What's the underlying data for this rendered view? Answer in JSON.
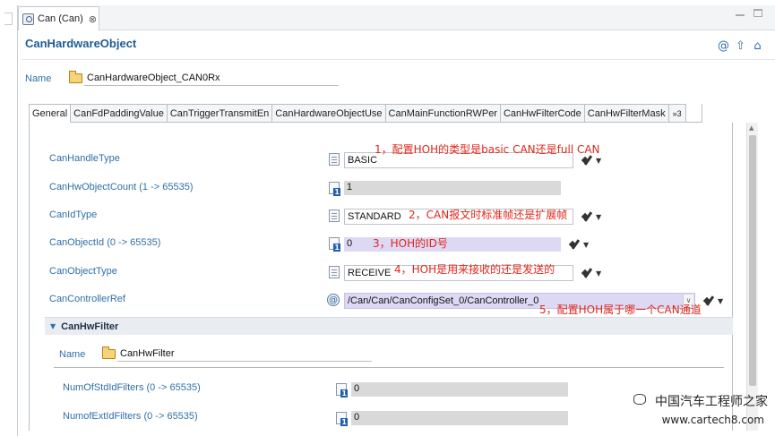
{
  "tab": {
    "label": "Can (Can)",
    "close": "⊗"
  },
  "header": {
    "title": "CanHardwareObject"
  },
  "name_field": {
    "label": "Name",
    "value": "CanHardwareObject_CAN0Rx"
  },
  "subtabs": [
    "General",
    "CanFdPaddingValue",
    "CanTriggerTransmitEn",
    "CanHardwareObjectUse",
    "CanMainFunctionRWPer",
    "CanHwFilterCode",
    "CanHwFilterMask"
  ],
  "subtab_more": "»3",
  "params": {
    "handle_type": {
      "label": "CanHandleType",
      "value": "BASIC"
    },
    "hw_object_count": {
      "label": "CanHwObjectCount (1 -> 65535)",
      "value": "1"
    },
    "id_type": {
      "label": "CanIdType",
      "value": "STANDARD"
    },
    "object_id": {
      "label": "CanObjectId (0 -> 65535)",
      "value": "0"
    },
    "object_type": {
      "label": "CanObjectType",
      "value": "RECEIVE"
    },
    "controller_ref": {
      "label": "CanControllerRef",
      "value": "/Can/Can/CanConfigSet_0/CanController_0"
    }
  },
  "annotations": {
    "a1": "1，配置HOH的类型是basic CAN还是full CAN",
    "a2": "2，CAN报文时标准帧还是扩展帧",
    "a3": "3，HOH的ID号",
    "a4": "4，HOH是用来接收的还是发送的",
    "a5": "5，配置HOH属于哪一个CAN通道"
  },
  "hw_filter": {
    "title": "CanHwFilter",
    "name_label": "Name",
    "name_value": "CanHwFilter",
    "std_filters": {
      "label": "NumOfStdIdFilters (0 -> 65535)",
      "value": "0"
    },
    "ext_filters": {
      "label": "NumofExtIdFilters (0 -> 65535)",
      "value": "0"
    }
  },
  "watermark": {
    "line1": "中国汽车工程师之家",
    "line2": "www.cartech8.com"
  }
}
